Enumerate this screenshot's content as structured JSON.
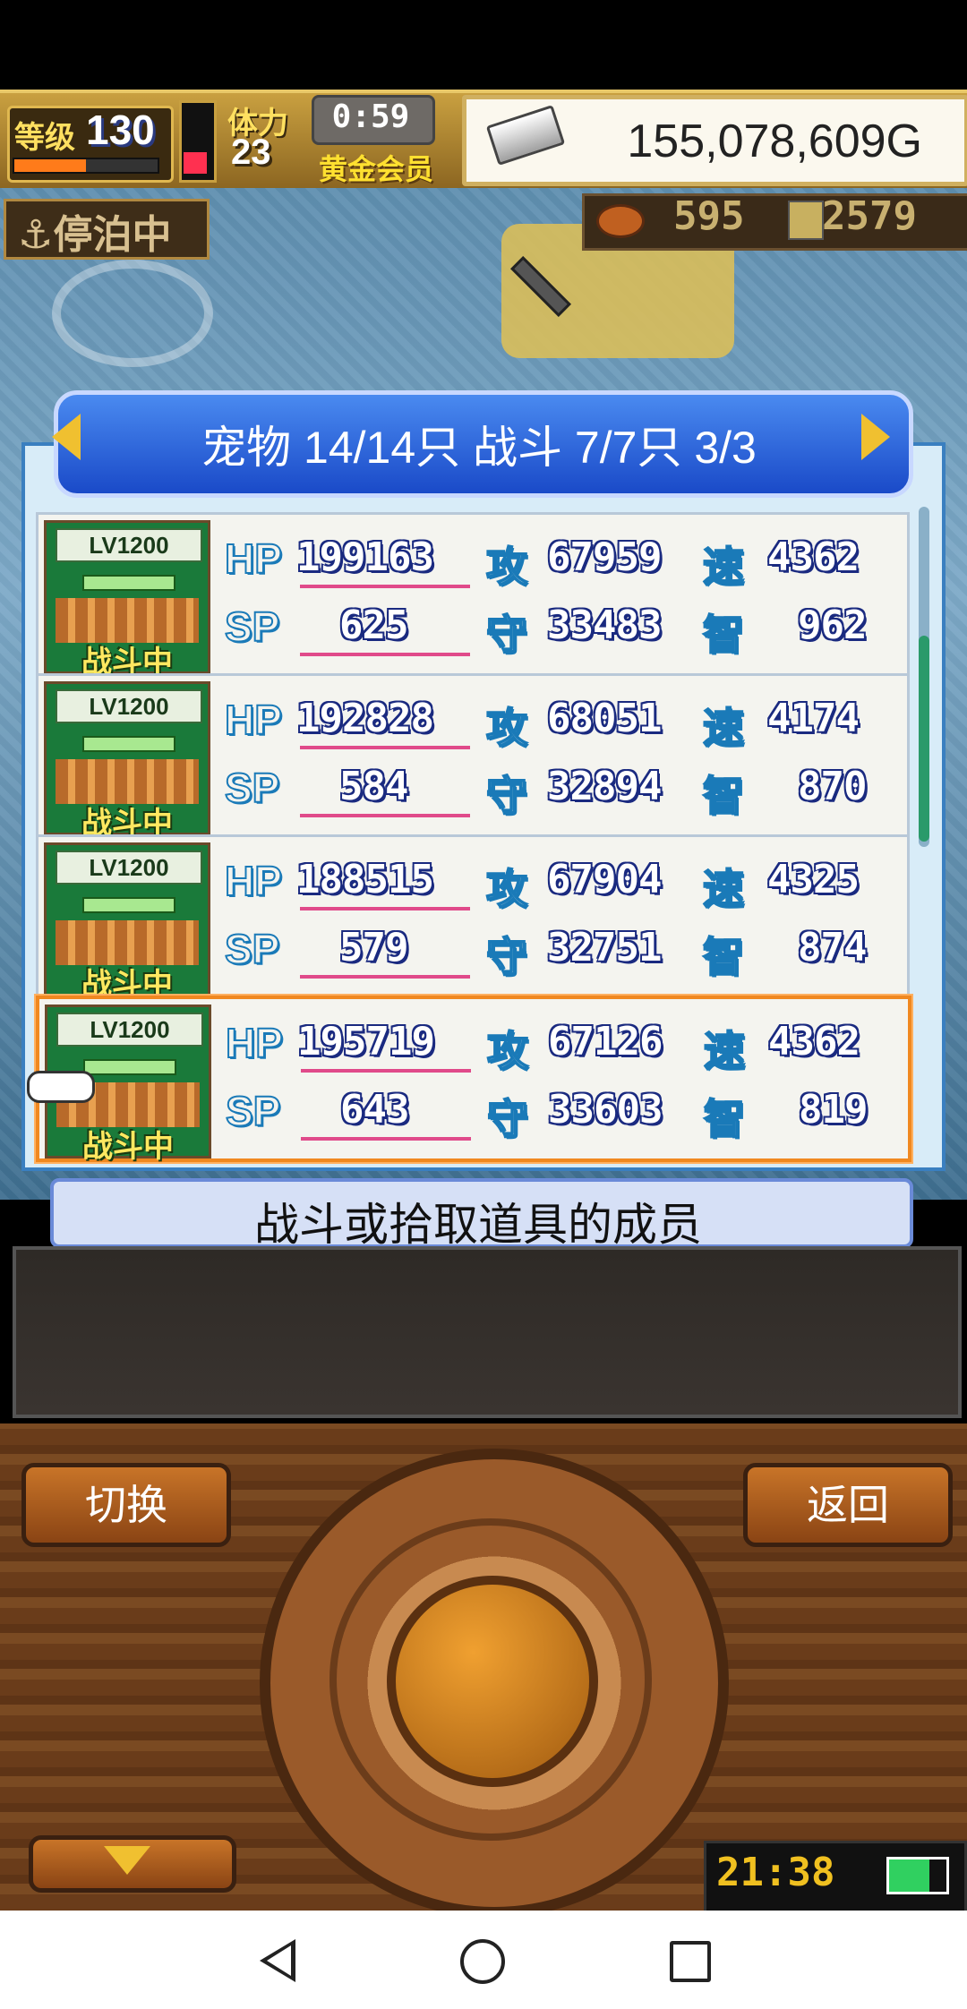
{
  "header": {
    "level_label": "等级",
    "level": "130",
    "exp_fraction": 0.5,
    "stamina_label": "体力",
    "stamina": "23",
    "timer": "0:59",
    "membership": "黄金会员",
    "gold": "155,078,609G"
  },
  "map": {
    "status": "⚓停泊中",
    "food_count": "595",
    "wood_count": "2579"
  },
  "panel": {
    "title": "宠物 14/14只 战斗 7/7只  3/3",
    "labels": {
      "hp": "HP",
      "sp": "SP",
      "atk": "攻",
      "def": "守",
      "spd": "速",
      "int": "智"
    },
    "pets": [
      {
        "level": "LV1200",
        "status": "战斗中",
        "hp": "199163",
        "sp": "625",
        "atk": "67959",
        "def": "33483",
        "spd": "4362",
        "int": "962"
      },
      {
        "level": "LV1200",
        "status": "战斗中",
        "hp": "192828",
        "sp": "584",
        "atk": "68051",
        "def": "32894",
        "spd": "4174",
        "int": "870"
      },
      {
        "level": "LV1200",
        "status": "战斗中",
        "hp": "188515",
        "sp": "579",
        "atk": "67904",
        "def": "32751",
        "spd": "4325",
        "int": "874"
      },
      {
        "level": "LV1200",
        "status": "战斗中",
        "hp": "195719",
        "sp": "643",
        "atk": "67126",
        "def": "33603",
        "spd": "4362",
        "int": "819"
      }
    ]
  },
  "description": "战斗或拾取道具的成员",
  "controls": {
    "switch_label": "切换",
    "back_label": "返回",
    "clock": "21:38"
  },
  "colors": {
    "selected_border": "#f08820",
    "panel_title_bg": "#1a4ac8",
    "value_outline": "#1a2a80",
    "label_outline": "#1a7ab8"
  }
}
